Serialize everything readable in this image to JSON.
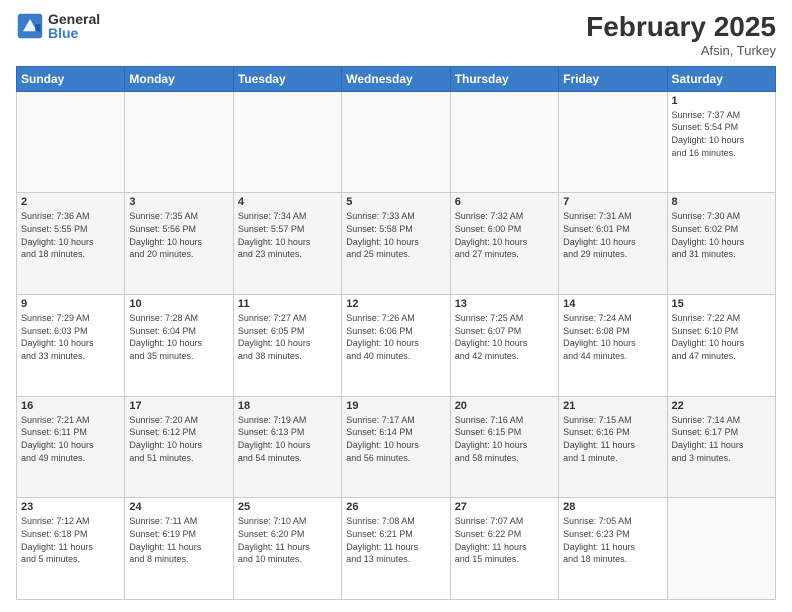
{
  "header": {
    "logo_general": "General",
    "logo_blue": "Blue",
    "month_title": "February 2025",
    "subtitle": "Afsin, Turkey"
  },
  "weekdays": [
    "Sunday",
    "Monday",
    "Tuesday",
    "Wednesday",
    "Thursday",
    "Friday",
    "Saturday"
  ],
  "weeks": [
    [
      {
        "day": "",
        "info": ""
      },
      {
        "day": "",
        "info": ""
      },
      {
        "day": "",
        "info": ""
      },
      {
        "day": "",
        "info": ""
      },
      {
        "day": "",
        "info": ""
      },
      {
        "day": "",
        "info": ""
      },
      {
        "day": "1",
        "info": "Sunrise: 7:37 AM\nSunset: 5:54 PM\nDaylight: 10 hours\nand 16 minutes."
      }
    ],
    [
      {
        "day": "2",
        "info": "Sunrise: 7:36 AM\nSunset: 5:55 PM\nDaylight: 10 hours\nand 18 minutes."
      },
      {
        "day": "3",
        "info": "Sunrise: 7:35 AM\nSunset: 5:56 PM\nDaylight: 10 hours\nand 20 minutes."
      },
      {
        "day": "4",
        "info": "Sunrise: 7:34 AM\nSunset: 5:57 PM\nDaylight: 10 hours\nand 23 minutes."
      },
      {
        "day": "5",
        "info": "Sunrise: 7:33 AM\nSunset: 5:58 PM\nDaylight: 10 hours\nand 25 minutes."
      },
      {
        "day": "6",
        "info": "Sunrise: 7:32 AM\nSunset: 6:00 PM\nDaylight: 10 hours\nand 27 minutes."
      },
      {
        "day": "7",
        "info": "Sunrise: 7:31 AM\nSunset: 6:01 PM\nDaylight: 10 hours\nand 29 minutes."
      },
      {
        "day": "8",
        "info": "Sunrise: 7:30 AM\nSunset: 6:02 PM\nDaylight: 10 hours\nand 31 minutes."
      }
    ],
    [
      {
        "day": "9",
        "info": "Sunrise: 7:29 AM\nSunset: 6:03 PM\nDaylight: 10 hours\nand 33 minutes."
      },
      {
        "day": "10",
        "info": "Sunrise: 7:28 AM\nSunset: 6:04 PM\nDaylight: 10 hours\nand 35 minutes."
      },
      {
        "day": "11",
        "info": "Sunrise: 7:27 AM\nSunset: 6:05 PM\nDaylight: 10 hours\nand 38 minutes."
      },
      {
        "day": "12",
        "info": "Sunrise: 7:26 AM\nSunset: 6:06 PM\nDaylight: 10 hours\nand 40 minutes."
      },
      {
        "day": "13",
        "info": "Sunrise: 7:25 AM\nSunset: 6:07 PM\nDaylight: 10 hours\nand 42 minutes."
      },
      {
        "day": "14",
        "info": "Sunrise: 7:24 AM\nSunset: 6:08 PM\nDaylight: 10 hours\nand 44 minutes."
      },
      {
        "day": "15",
        "info": "Sunrise: 7:22 AM\nSunset: 6:10 PM\nDaylight: 10 hours\nand 47 minutes."
      }
    ],
    [
      {
        "day": "16",
        "info": "Sunrise: 7:21 AM\nSunset: 6:11 PM\nDaylight: 10 hours\nand 49 minutes."
      },
      {
        "day": "17",
        "info": "Sunrise: 7:20 AM\nSunset: 6:12 PM\nDaylight: 10 hours\nand 51 minutes."
      },
      {
        "day": "18",
        "info": "Sunrise: 7:19 AM\nSunset: 6:13 PM\nDaylight: 10 hours\nand 54 minutes."
      },
      {
        "day": "19",
        "info": "Sunrise: 7:17 AM\nSunset: 6:14 PM\nDaylight: 10 hours\nand 56 minutes."
      },
      {
        "day": "20",
        "info": "Sunrise: 7:16 AM\nSunset: 6:15 PM\nDaylight: 10 hours\nand 58 minutes."
      },
      {
        "day": "21",
        "info": "Sunrise: 7:15 AM\nSunset: 6:16 PM\nDaylight: 11 hours\nand 1 minute."
      },
      {
        "day": "22",
        "info": "Sunrise: 7:14 AM\nSunset: 6:17 PM\nDaylight: 11 hours\nand 3 minutes."
      }
    ],
    [
      {
        "day": "23",
        "info": "Sunrise: 7:12 AM\nSunset: 6:18 PM\nDaylight: 11 hours\nand 5 minutes."
      },
      {
        "day": "24",
        "info": "Sunrise: 7:11 AM\nSunset: 6:19 PM\nDaylight: 11 hours\nand 8 minutes."
      },
      {
        "day": "25",
        "info": "Sunrise: 7:10 AM\nSunset: 6:20 PM\nDaylight: 11 hours\nand 10 minutes."
      },
      {
        "day": "26",
        "info": "Sunrise: 7:08 AM\nSunset: 6:21 PM\nDaylight: 11 hours\nand 13 minutes."
      },
      {
        "day": "27",
        "info": "Sunrise: 7:07 AM\nSunset: 6:22 PM\nDaylight: 11 hours\nand 15 minutes."
      },
      {
        "day": "28",
        "info": "Sunrise: 7:05 AM\nSunset: 6:23 PM\nDaylight: 11 hours\nand 18 minutes."
      },
      {
        "day": "",
        "info": ""
      }
    ]
  ]
}
